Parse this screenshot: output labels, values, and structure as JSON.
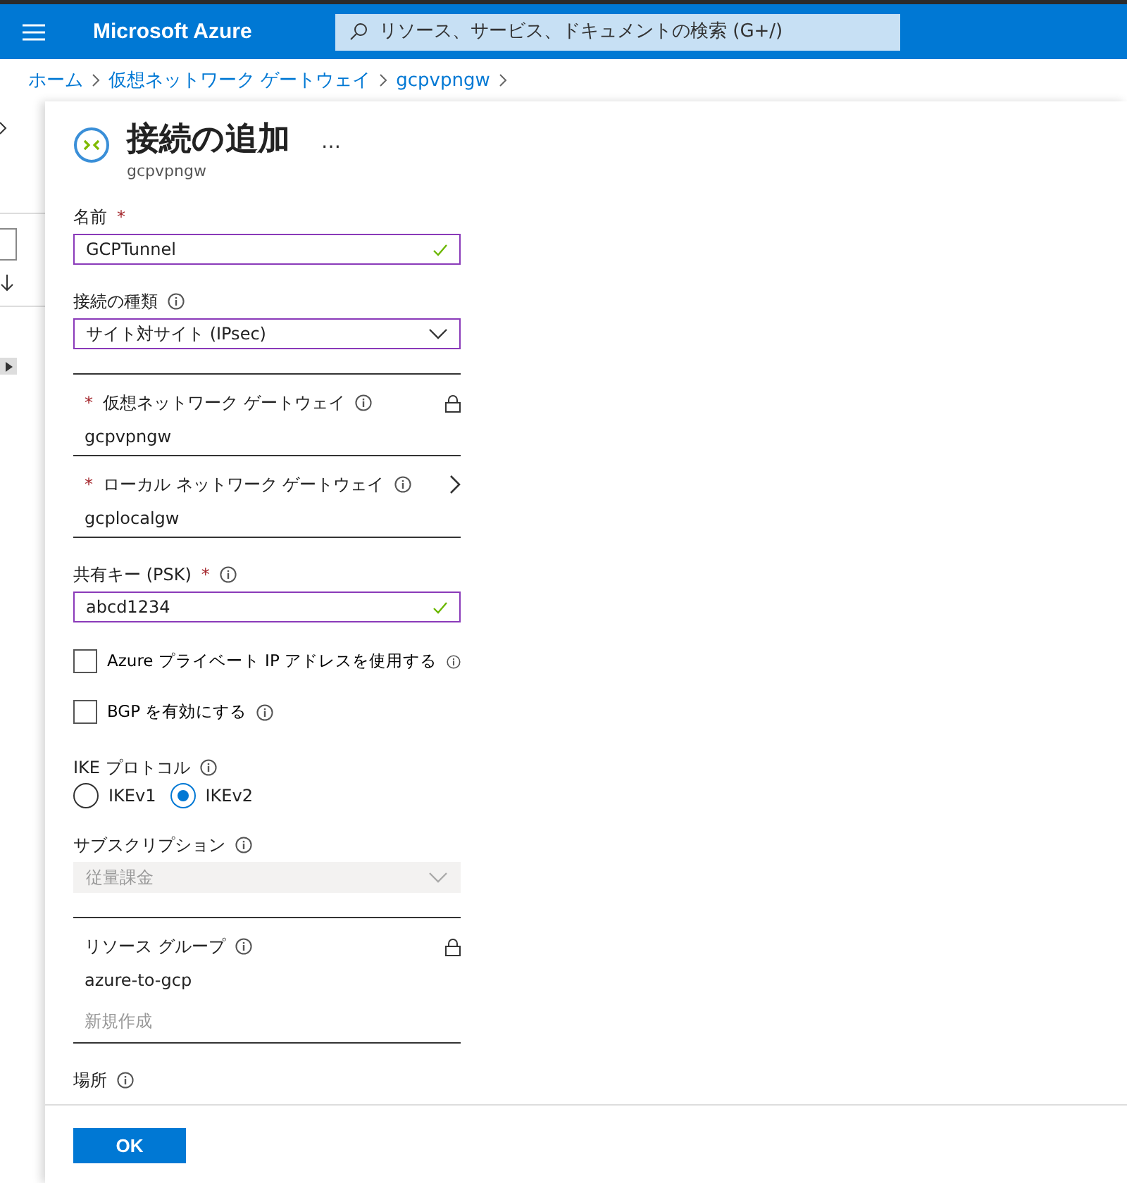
{
  "topbar": {
    "title": "Microsoft Azure",
    "search": {
      "placeholder": "リソース、サービス、ドキュメントの検索 (G+/)"
    }
  },
  "breadcrumb": [
    "ホーム",
    "仮想ネットワーク ゲートウェイ",
    "gcpvpngw"
  ],
  "blade": {
    "title": "接続の追加",
    "more": "…",
    "subtitle": "gcpvpngw"
  },
  "fields": [
    {
      "kind": "text",
      "label": "名前",
      "required_mark": "*",
      "value": "GCPTunnel",
      "valid": true
    },
    {
      "kind": "select",
      "label": "接続の種類",
      "info": true,
      "value": "サイト対サイト (IPsec)",
      "disabled": false
    },
    {
      "kind": "picker",
      "label": "仮想ネットワーク ゲートウェイ",
      "required_mark": "*",
      "info": true,
      "value": "gcpvpngw",
      "locked": true
    },
    {
      "kind": "picker",
      "label": "ローカル ネットワーク ゲートウェイ",
      "required_mark": "*",
      "info": true,
      "value": "gcplocalgw",
      "locked": false
    },
    {
      "kind": "text",
      "label": "共有キー (PSK)",
      "required_mark": "*",
      "info": true,
      "value": "abcd1234",
      "valid": true
    },
    {
      "kind": "checkbox",
      "label": "Azure プライベート IP アドレスを使用する",
      "info": true,
      "checked": false
    },
    {
      "kind": "checkbox",
      "label": "BGP を有効にする",
      "info": true,
      "checked": false
    },
    {
      "kind": "radio",
      "label": "IKE プロトコル",
      "info": true,
      "options": [
        {
          "label": "IKEv1",
          "selected": false
        },
        {
          "label": "IKEv2",
          "selected": true
        }
      ]
    },
    {
      "kind": "select",
      "label": "サブスクリプション",
      "info": true,
      "value": "従量課金",
      "disabled": true
    },
    {
      "kind": "picker",
      "label": "リソース グループ",
      "info": true,
      "value": "azure-to-gcp",
      "locked": true,
      "action": "新規作成"
    },
    {
      "kind": "label",
      "label": "場所",
      "info": true
    }
  ],
  "footer": {
    "button": "OK"
  }
}
